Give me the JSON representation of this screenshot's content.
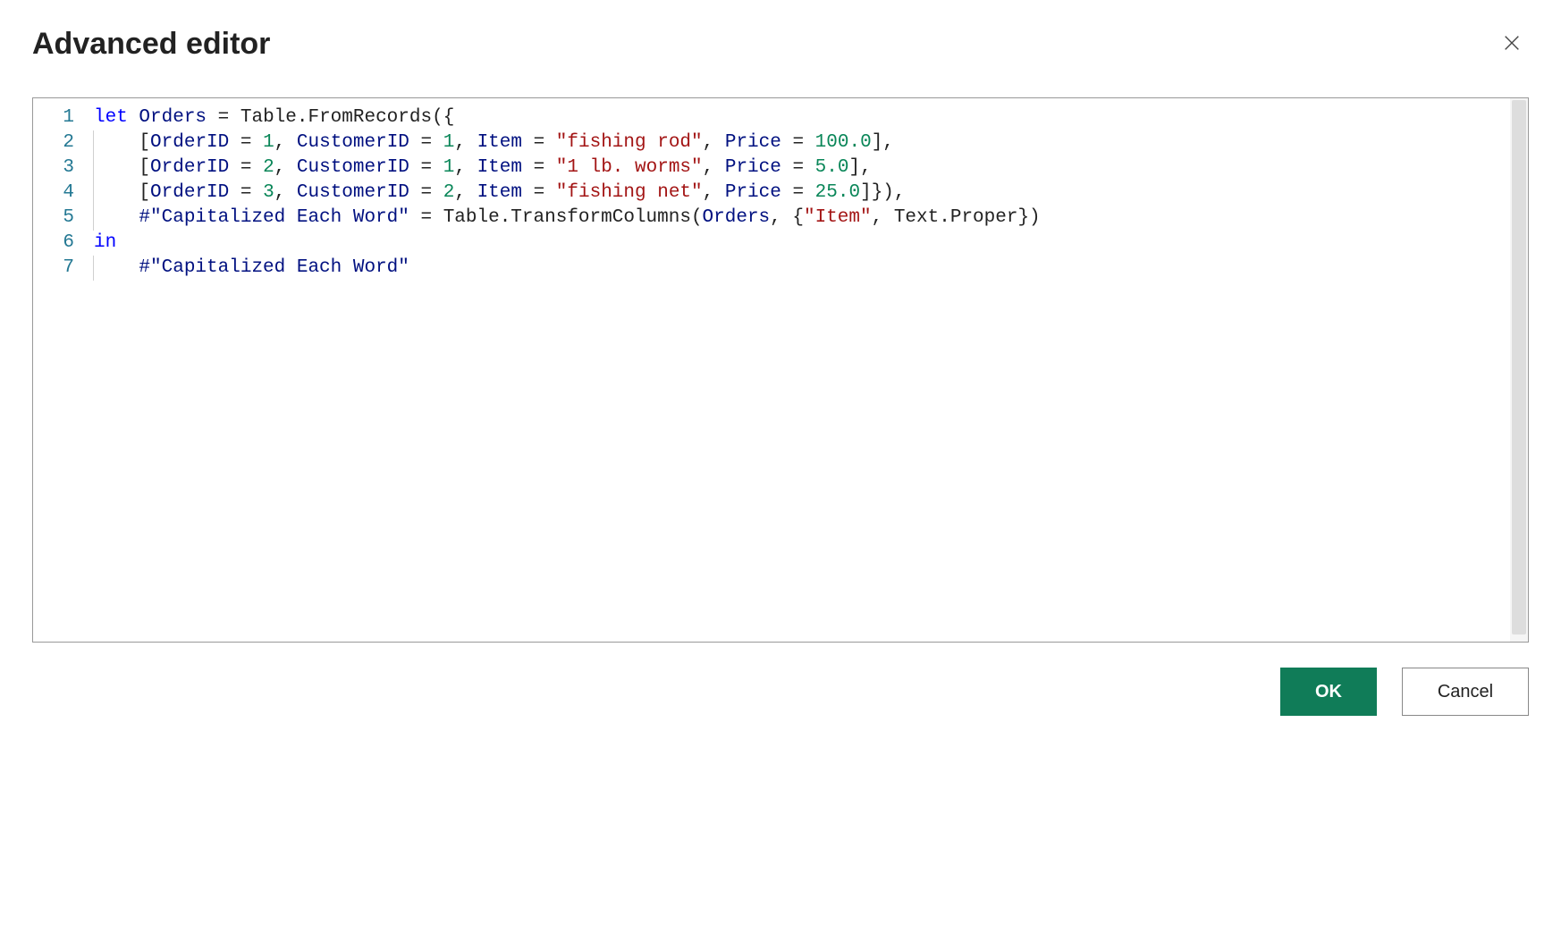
{
  "dialog": {
    "title": "Advanced editor",
    "ok_label": "OK",
    "cancel_label": "Cancel"
  },
  "editor": {
    "line_numbers": [
      "1",
      "2",
      "3",
      "4",
      "5",
      "6",
      "7"
    ],
    "lines": [
      {
        "indent": 0,
        "tokens": [
          {
            "t": "let",
            "c": "kw"
          },
          {
            "t": " ",
            "c": "punc"
          },
          {
            "t": "Orders",
            "c": "ident"
          },
          {
            "t": " = ",
            "c": "punc"
          },
          {
            "t": "Table.FromRecords",
            "c": "fn"
          },
          {
            "t": "({",
            "c": "punc"
          }
        ]
      },
      {
        "indent": 1,
        "tokens": [
          {
            "t": "[",
            "c": "punc"
          },
          {
            "t": "OrderID",
            "c": "ident"
          },
          {
            "t": " = ",
            "c": "punc"
          },
          {
            "t": "1",
            "c": "num"
          },
          {
            "t": ", ",
            "c": "punc"
          },
          {
            "t": "CustomerID",
            "c": "ident"
          },
          {
            "t": " = ",
            "c": "punc"
          },
          {
            "t": "1",
            "c": "num"
          },
          {
            "t": ", ",
            "c": "punc"
          },
          {
            "t": "Item",
            "c": "ident"
          },
          {
            "t": " = ",
            "c": "punc"
          },
          {
            "t": "\"fishing rod\"",
            "c": "str"
          },
          {
            "t": ", ",
            "c": "punc"
          },
          {
            "t": "Price",
            "c": "ident"
          },
          {
            "t": " = ",
            "c": "punc"
          },
          {
            "t": "100.0",
            "c": "num"
          },
          {
            "t": "],",
            "c": "punc"
          }
        ]
      },
      {
        "indent": 1,
        "tokens": [
          {
            "t": "[",
            "c": "punc"
          },
          {
            "t": "OrderID",
            "c": "ident"
          },
          {
            "t": " = ",
            "c": "punc"
          },
          {
            "t": "2",
            "c": "num"
          },
          {
            "t": ", ",
            "c": "punc"
          },
          {
            "t": "CustomerID",
            "c": "ident"
          },
          {
            "t": " = ",
            "c": "punc"
          },
          {
            "t": "1",
            "c": "num"
          },
          {
            "t": ", ",
            "c": "punc"
          },
          {
            "t": "Item",
            "c": "ident"
          },
          {
            "t": " = ",
            "c": "punc"
          },
          {
            "t": "\"1 lb. worms\"",
            "c": "str"
          },
          {
            "t": ", ",
            "c": "punc"
          },
          {
            "t": "Price",
            "c": "ident"
          },
          {
            "t": " = ",
            "c": "punc"
          },
          {
            "t": "5.0",
            "c": "num"
          },
          {
            "t": "],",
            "c": "punc"
          }
        ]
      },
      {
        "indent": 1,
        "tokens": [
          {
            "t": "[",
            "c": "punc"
          },
          {
            "t": "OrderID",
            "c": "ident"
          },
          {
            "t": " = ",
            "c": "punc"
          },
          {
            "t": "3",
            "c": "num"
          },
          {
            "t": ", ",
            "c": "punc"
          },
          {
            "t": "CustomerID",
            "c": "ident"
          },
          {
            "t": " = ",
            "c": "punc"
          },
          {
            "t": "2",
            "c": "num"
          },
          {
            "t": ", ",
            "c": "punc"
          },
          {
            "t": "Item",
            "c": "ident"
          },
          {
            "t": " = ",
            "c": "punc"
          },
          {
            "t": "\"fishing net\"",
            "c": "str"
          },
          {
            "t": ", ",
            "c": "punc"
          },
          {
            "t": "Price",
            "c": "ident"
          },
          {
            "t": " = ",
            "c": "punc"
          },
          {
            "t": "25.0",
            "c": "num"
          },
          {
            "t": "]}),",
            "c": "punc"
          }
        ]
      },
      {
        "indent": 1,
        "tokens": [
          {
            "t": "#\"Capitalized Each Word\"",
            "c": "ident"
          },
          {
            "t": " = ",
            "c": "punc"
          },
          {
            "t": "Table.TransformColumns",
            "c": "fn"
          },
          {
            "t": "(",
            "c": "punc"
          },
          {
            "t": "Orders",
            "c": "ident"
          },
          {
            "t": ", {",
            "c": "punc"
          },
          {
            "t": "\"Item\"",
            "c": "str"
          },
          {
            "t": ", ",
            "c": "punc"
          },
          {
            "t": "Text.Proper",
            "c": "fn"
          },
          {
            "t": "})",
            "c": "punc"
          }
        ]
      },
      {
        "indent": 0,
        "tokens": [
          {
            "t": "in",
            "c": "kw"
          }
        ]
      },
      {
        "indent": 1,
        "tokens": [
          {
            "t": "#\"Capitalized Each Word\"",
            "c": "ident"
          }
        ]
      }
    ]
  }
}
